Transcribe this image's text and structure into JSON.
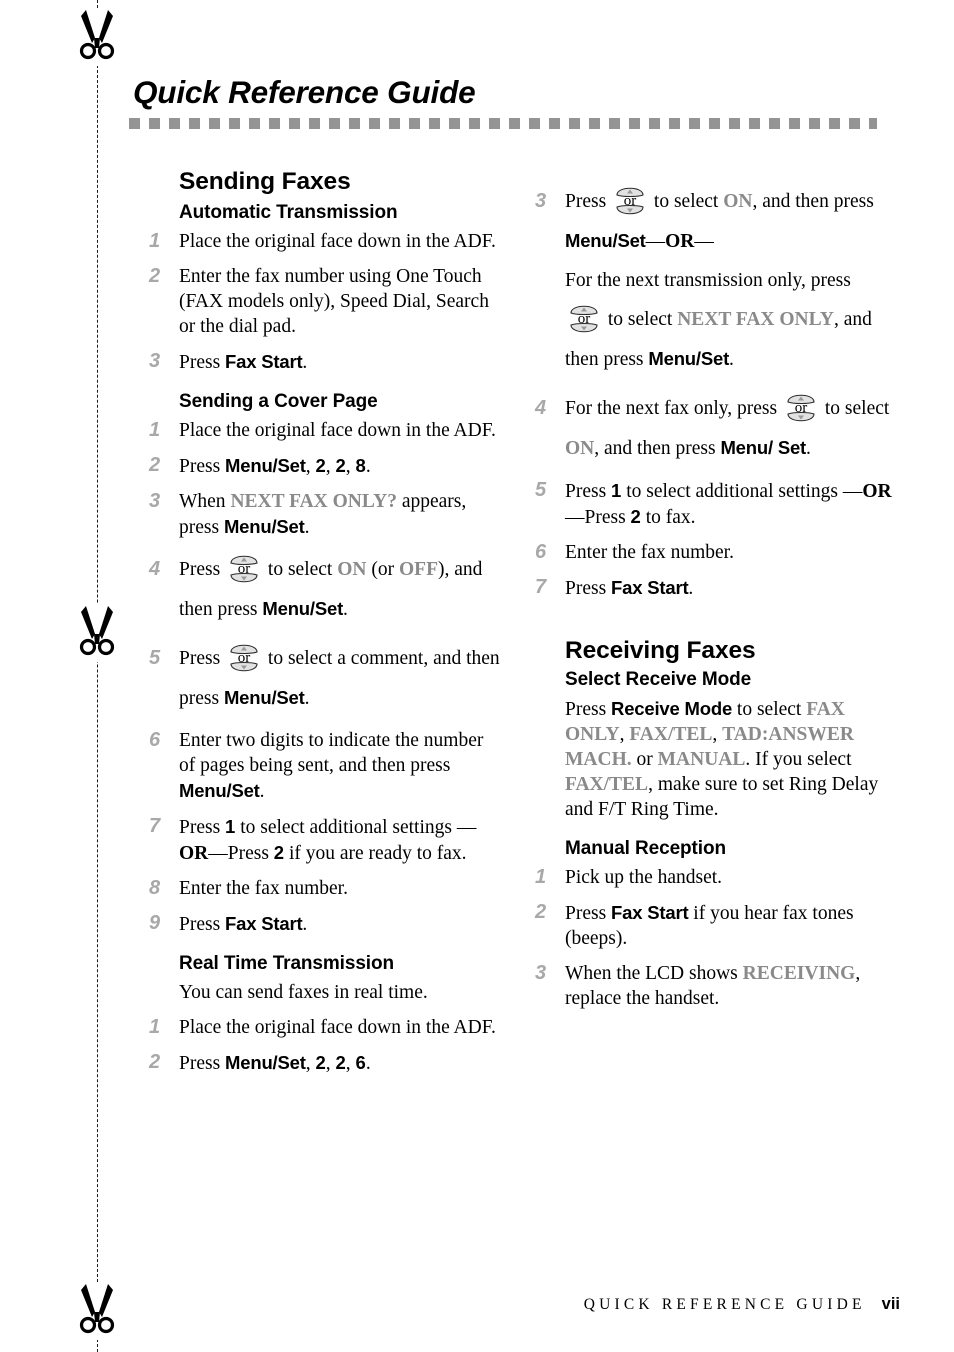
{
  "page": {
    "title": "Quick Reference Guide",
    "footer_text": "QUICK REFERENCE GUIDE",
    "footer_page": "vii",
    "icons": {
      "scissors": "scissors-icon",
      "navkey": "up-down-navigation-key-icon",
      "navkey_label": "or"
    },
    "colors": {
      "lcd_text": "#8a8a8a",
      "step_number": "#a8a8a8",
      "rule": "#949494",
      "body_text": "#000000"
    }
  },
  "left_column": {
    "section_title": "Sending Faxes",
    "groups": [
      {
        "heading": "Automatic Transmission",
        "steps": [
          {
            "num": "1",
            "html": "Place the original face down in the ADF."
          },
          {
            "num": "2",
            "html": "Enter the fax number using One Touch (FAX models only), Speed Dial, Search or the dial pad."
          },
          {
            "num": "3",
            "html": "Press <b class=\"key\">Fax Start</b>."
          }
        ]
      },
      {
        "heading": "Sending a Cover Page",
        "steps": [
          {
            "num": "1",
            "html": " Place the original face down in the ADF."
          },
          {
            "num": "2",
            "html": "Press <b class=\"key\">Menu/Set</b>, <b class=\"digit\">2</b>, <b class=\"digit\">2</b>, <b class=\"digit\">8</b>."
          },
          {
            "num": "3",
            "html": "When <span class=\"lcd\">NEXT FAX ONLY?</span> appears, press <b class=\"key\">Menu/Set</b>."
          },
          {
            "num": "4",
            "html": "Press {KEY} to select <span class=\"lcd\">ON</span> (or <span class=\"lcd\">OFF</span>), and then press <b class=\"key\">Menu/Set</b>."
          },
          {
            "num": "5",
            "html": "Press {KEY} to select a comment, and then press <b class=\"key\">Menu/Set</b>."
          },
          {
            "num": "6",
            "html": "Enter two digits to indicate the number of pages being sent, and then press <b class=\"key\">Menu/Set</b>."
          },
          {
            "num": "7",
            "html": "Press <b class=\"digit\">1</b> to select additional settings &#8212;<b class=\"or-word\">OR</b>&#8212;Press <b class=\"digit\">2</b> if you are ready to fax."
          },
          {
            "num": "8",
            "html": "Enter the fax number."
          },
          {
            "num": "9",
            "html": "Press <b class=\"key\">Fax Start</b>."
          }
        ]
      },
      {
        "heading": "Real Time Transmission",
        "intro": "You can send faxes in real time.",
        "steps": [
          {
            "num": "1",
            "html": "Place the original face down in the ADF."
          },
          {
            "num": "2",
            "html": "Press <b class=\"key\">Menu/Set</b>, <b class=\"digit\">2</b>, <b class=\"digit\">2</b>, <b class=\"digit\">6</b>."
          }
        ]
      }
    ]
  },
  "right_column": {
    "continued_steps": [
      {
        "num": "3",
        "html": "Press {KEY} to select <span class=\"lcd\">ON</span>, and then press <b class=\"key\">Menu/Set</b>&#8212;<b class=\"or-word\">OR</b>&#8212;<br>For the next transmission only, press {KEY} to select <span class=\"lcd\">NEXT FAX ONLY</span>, and then press <b class=\"key\">Menu/Set</b>."
      },
      {
        "num": "4",
        "html": "For the next fax only, press {KEY} to select <span class=\"lcd\">ON</span>, and then press <b class=\"key\">Menu/ Set</b>."
      },
      {
        "num": "5",
        "html": "Press <b class=\"digit\">1</b> to select additional settings &#8212;<b class=\"or-word\">OR</b>&#8212;Press <b class=\"digit\">2</b> to fax."
      },
      {
        "num": "6",
        "html": "Enter the fax number."
      },
      {
        "num": "7",
        "html": "Press <b class=\"key\">Fax Start</b>."
      }
    ],
    "section_title": "Receiving Faxes",
    "groups": [
      {
        "heading": "Select Receive Mode",
        "intro": "Press <b class=\"key\">Receive Mode</b> to select <span class=\"lcd\">FAX ONLY</span>, <span class=\"lcd\">FAX/TEL</span>, <span class=\"lcd\">TAD:ANSWER MACH.</span> or <span class=\"lcd\">MANUAL</span>. If you select <span class=\"lcd\">FAX/TEL</span>, make sure to set Ring Delay and F/T Ring Time."
      },
      {
        "heading": "Manual Reception",
        "steps": [
          {
            "num": "1",
            "html": "Pick up the handset."
          },
          {
            "num": "2",
            "html": "Press <b class=\"key\">Fax Start</b> if you hear fax tones (beeps)."
          },
          {
            "num": "3",
            "html": "When the LCD shows <span class=\"lcd\">RECEIVING</span>, replace the handset."
          }
        ]
      }
    ]
  }
}
